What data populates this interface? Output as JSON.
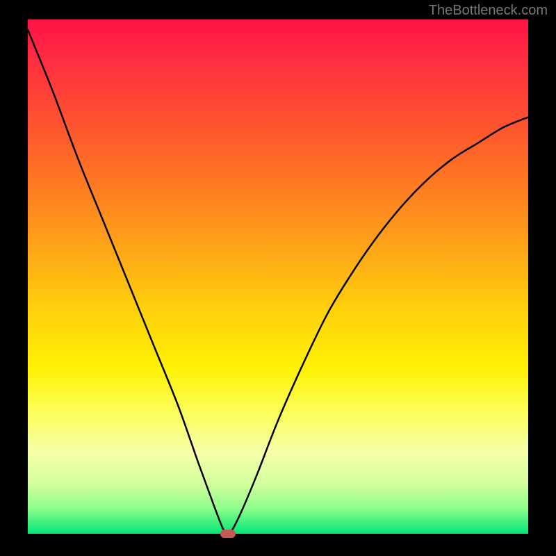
{
  "watermark": {
    "text": "TheBottleneck.com"
  },
  "colors": {
    "top": "#ff1246",
    "mid": "#ffe600",
    "bottom": "#00e676",
    "curve": "#000000",
    "marker": "#c65a52",
    "background": "#000000",
    "watermark_text": "#777777"
  },
  "plot": {
    "x_range": [
      0,
      100
    ],
    "y_range": [
      0,
      100
    ],
    "x_label": "",
    "y_label": "",
    "grid": false,
    "legend": false
  },
  "chart_data": {
    "type": "line",
    "title": "",
    "xlabel": "",
    "ylabel": "",
    "xlim": [
      0,
      100
    ],
    "ylim": [
      0,
      100
    ],
    "series": [
      {
        "name": "bottleneck-curve",
        "x": [
          0,
          5,
          10,
          15,
          20,
          25,
          30,
          34,
          37,
          39,
          40,
          41,
          43,
          46,
          50,
          55,
          60,
          65,
          70,
          75,
          80,
          85,
          90,
          95,
          100
        ],
        "values": [
          98,
          86,
          73,
          61,
          49,
          37,
          25,
          14,
          6,
          1,
          0,
          1,
          5,
          12,
          22,
          33,
          43,
          51,
          58,
          64,
          69,
          73,
          76,
          79,
          81
        ]
      }
    ],
    "marker": {
      "x": 40,
      "y": 0,
      "name": "bottleneck-point"
    }
  }
}
